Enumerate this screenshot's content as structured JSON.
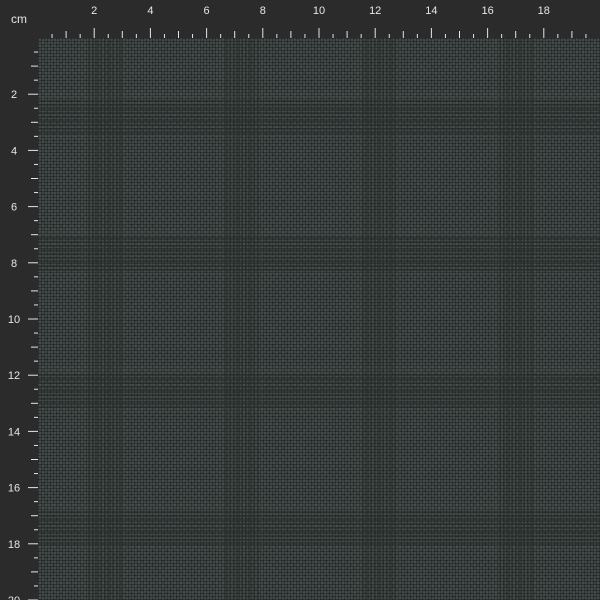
{
  "ruler": {
    "unit_label": "cm",
    "top_ticks": [
      "2",
      "4",
      "6",
      "8",
      "10",
      "12",
      "14",
      "16",
      "18"
    ],
    "left_ticks": [
      "2",
      "4",
      "6",
      "8",
      "10",
      "12",
      "14",
      "16",
      "18",
      "20"
    ]
  },
  "colors": {
    "ruler_bg": "#2b2b2b",
    "ruler_text": "#e6e6e6",
    "fabric_base": "#384140",
    "fabric_dark": "#1f2524",
    "fabric_light": "#4a5452"
  },
  "fabric": {
    "pattern": "glen-check"
  }
}
